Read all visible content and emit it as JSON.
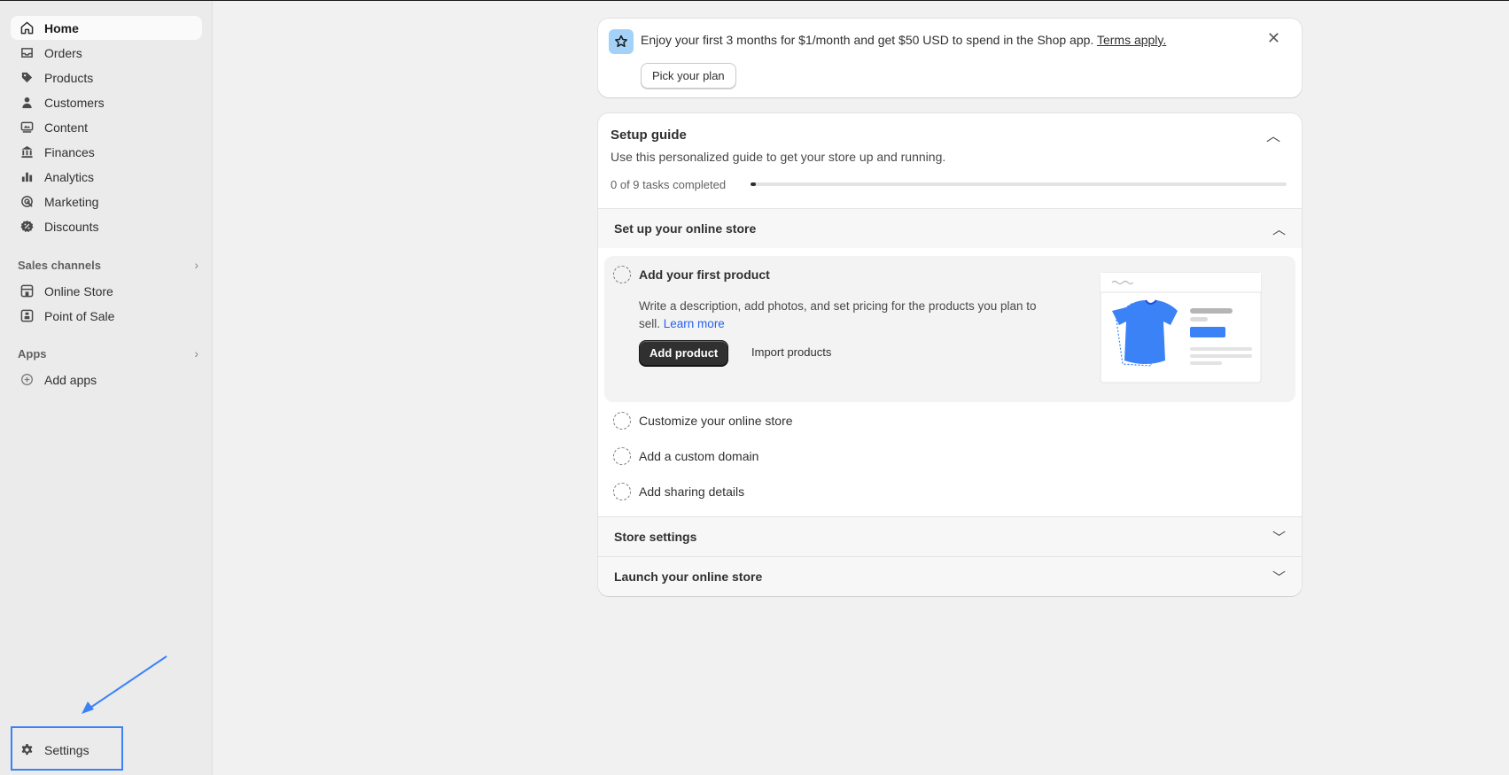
{
  "sidebar": {
    "items": [
      {
        "label": "Home",
        "icon": "home-icon",
        "active": true
      },
      {
        "label": "Orders",
        "icon": "inbox-icon"
      },
      {
        "label": "Products",
        "icon": "tag-icon"
      },
      {
        "label": "Customers",
        "icon": "person-icon"
      },
      {
        "label": "Content",
        "icon": "content-icon"
      },
      {
        "label": "Finances",
        "icon": "bank-icon"
      },
      {
        "label": "Analytics",
        "icon": "bar-chart-icon"
      },
      {
        "label": "Marketing",
        "icon": "target-icon"
      },
      {
        "label": "Discounts",
        "icon": "discount-badge-icon"
      }
    ],
    "sales_channels": {
      "heading": "Sales channels",
      "items": [
        {
          "label": "Online Store",
          "icon": "storefront-icon"
        },
        {
          "label": "Point of Sale",
          "icon": "pos-icon"
        }
      ]
    },
    "apps": {
      "heading": "Apps",
      "items": [
        {
          "label": "Add apps",
          "icon": "plus-circle-icon"
        }
      ]
    },
    "settings": {
      "label": "Settings",
      "icon": "gear-icon"
    }
  },
  "banner": {
    "text": "Enjoy your first 3 months for $1/month and get $50 USD to spend in the Shop app.",
    "link": "Terms apply.",
    "button": "Pick your plan",
    "icon": "star-icon",
    "close_icon": "close-icon"
  },
  "setup_guide": {
    "title": "Setup guide",
    "subtitle": "Use this personalized guide to get your store up and running.",
    "progress_text": "0 of 9 tasks completed",
    "progress_fraction": 0.01,
    "sections": {
      "online_store": {
        "title": "Set up your online store",
        "expanded_task": {
          "title": "Add your first product",
          "description": "Write a description, add photos, and set pricing for the products you plan to sell.",
          "learn_more": "Learn more",
          "primary_button": "Add product",
          "secondary_button": "Import products"
        },
        "tasks": [
          {
            "title": "Customize your online store"
          },
          {
            "title": "Add a custom domain"
          },
          {
            "title": "Add sharing details"
          }
        ]
      },
      "store_settings": {
        "title": "Store settings"
      },
      "launch": {
        "title": "Launch your online store"
      }
    }
  },
  "colors": {
    "accent_blue": "#3b82f6",
    "primary_button": "#303030",
    "link_blue": "#2563eb",
    "banner_icon_bg": "#a4d1f7"
  }
}
